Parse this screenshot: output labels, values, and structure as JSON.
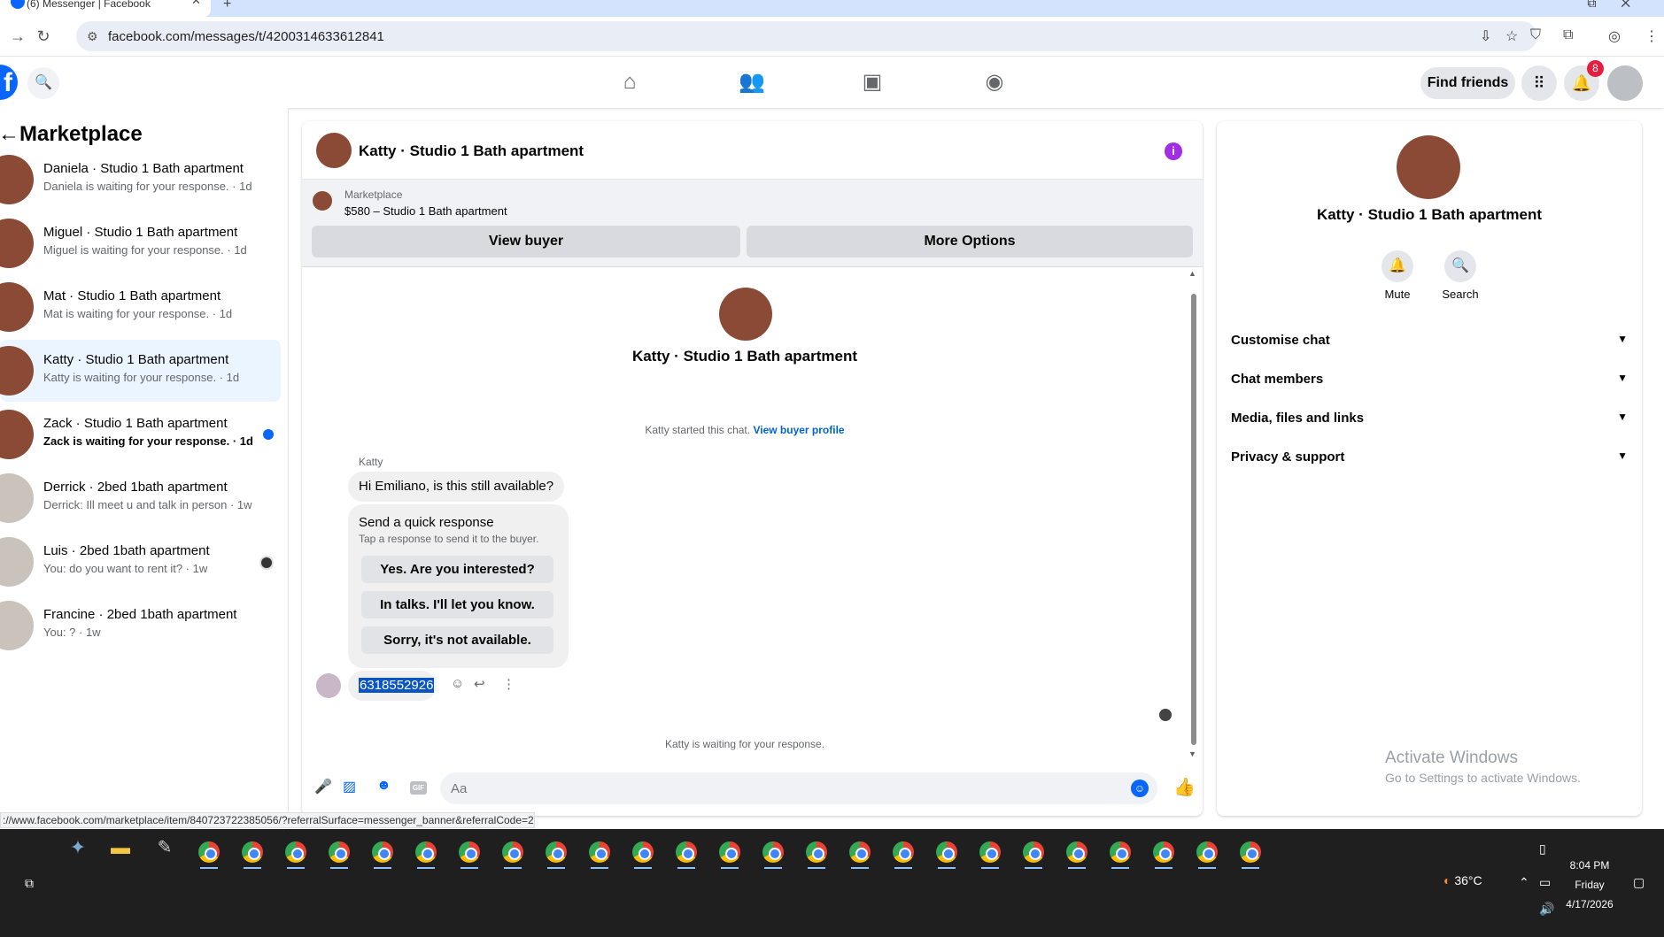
{
  "browser": {
    "tab_title": "(6) Messenger | Facebook",
    "url": "facebook.com/messages/t/4200314633612841",
    "status_url": "://www.facebook.com/marketplace/item/840723722385056/?referralSurface=messenger_banner&referralCode=2"
  },
  "header": {
    "find_friends": "Find friends",
    "notif_count": "8"
  },
  "sidebar": {
    "title": "Marketplace",
    "conversations": [
      {
        "name": "Daniela · Studio 1 Bath apartment",
        "sub": "Daniela is waiting for your response. · 1d"
      },
      {
        "name": "Miguel · Studio 1 Bath apartment",
        "sub": "Miguel is waiting for your response. · 1d"
      },
      {
        "name": "Mat · Studio 1 Bath apartment",
        "sub": "Mat is waiting for your response. · 1d"
      },
      {
        "name": "Katty · Studio 1 Bath apartment",
        "sub": "Katty is waiting for your response. · 1d"
      },
      {
        "name": "Zack · Studio 1 Bath apartment",
        "sub": "Zack is waiting for your response. · 1d"
      },
      {
        "name": "Derrick · 2bed 1bath apartment",
        "sub": "Derrick: Ill meet u and talk in person · 1w"
      },
      {
        "name": "Luis · 2bed 1bath apartment",
        "sub": "You: do you want to rent it? · 1w"
      },
      {
        "name": "Francine · 2bed 1bath apartment",
        "sub": "You: ? · 1w"
      }
    ]
  },
  "chat": {
    "title": "Katty · Studio 1 Bath apartment",
    "marketplace_label": "Marketplace",
    "listing": "$580 – Studio 1 Bath apartment",
    "view_buyer": "View buyer",
    "more_options": "More Options",
    "profile_name": "Katty · Studio 1 Bath apartment",
    "started_text": "Katty started this chat.",
    "view_buyer_profile": "View buyer profile",
    "sender": "Katty",
    "message1": "Hi Emiliano, is this still available?",
    "quick_title": "Send a quick response",
    "quick_sub": "Tap a response to send it to the buyer.",
    "quick_options": [
      "Yes. Are you interested?",
      "In talks. I'll let you know.",
      "Sorry, it's not available."
    ],
    "phone": "6318552926",
    "waiting": "Katty is waiting for your response.",
    "composer_placeholder": "Aa",
    "gif": "GIF"
  },
  "right_panel": {
    "name": "Katty · Studio 1 Bath apartment",
    "mute": "Mute",
    "search": "Search",
    "sections": [
      "Customise chat",
      "Chat members",
      "Media, files and links",
      "Privacy & support"
    ]
  },
  "watermark": {
    "line1": "Activate Windows",
    "line2": "Go to Settings to activate Windows."
  },
  "taskbar": {
    "temperature": "36°C",
    "time": "8:04 PM",
    "day": "Friday",
    "date": "4/17/2026"
  },
  "colors": {
    "accent": "#0866ff",
    "active_conv": "#ebf5ff",
    "info": "#a32ce5",
    "badge": "#e41e3f"
  }
}
